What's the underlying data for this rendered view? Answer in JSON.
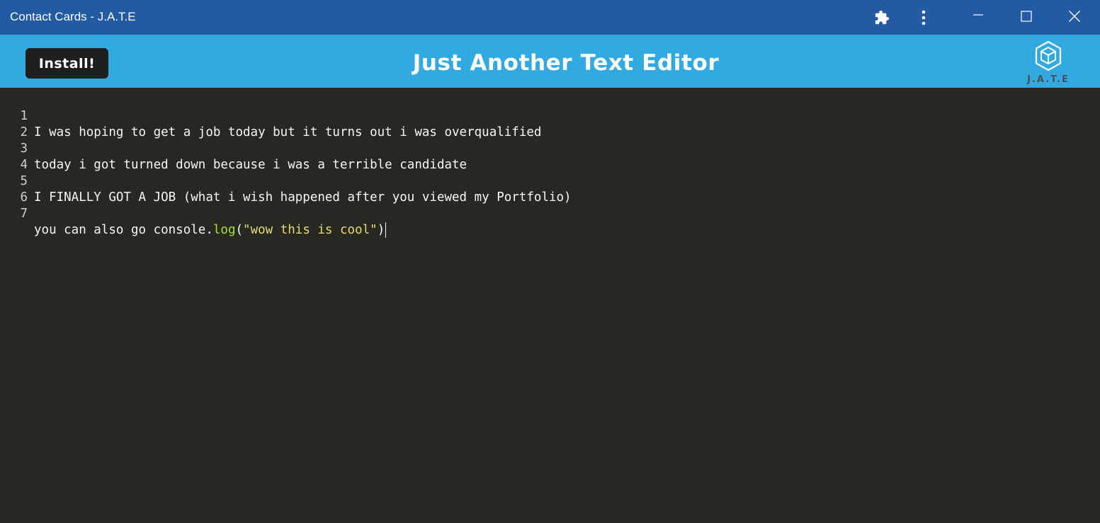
{
  "window": {
    "title": "Contact Cards - J.A.T.E",
    "titlebar_color": "#225aa3",
    "controls": {
      "extensions_icon": "puzzle-piece-icon",
      "menu_icon": "vertical-ellipsis-icon",
      "minimize_icon": "minimize-icon",
      "maximize_icon": "maximize-icon",
      "close_icon": "close-icon"
    }
  },
  "header": {
    "background": "#31a9e1",
    "install_label": "Install!",
    "title": "Just Another Text Editor",
    "logo_text": "J.A.T.E",
    "logo_icon": "hexagon-cube-logo-icon"
  },
  "editor": {
    "theme": "monokai",
    "background": "#272822",
    "lines": [
      {
        "number": "1",
        "text": "I was hoping to get a job today but it turns out i was overqualified"
      },
      {
        "number": "2",
        "text": ""
      },
      {
        "number": "3",
        "text": "today i got turned down because i was a terrible candidate"
      },
      {
        "number": "4",
        "text": ""
      },
      {
        "number": "5",
        "text": "I FINALLY GOT A JOB (what i wish happened after you viewed my Portfolio)"
      },
      {
        "number": "6",
        "text": ""
      },
      {
        "number": "7",
        "tokens": {
          "prefix": "you can also go console.",
          "fn": "log",
          "open": "(",
          "string": "\"wow this is cool\"",
          "close": ")"
        }
      }
    ]
  }
}
